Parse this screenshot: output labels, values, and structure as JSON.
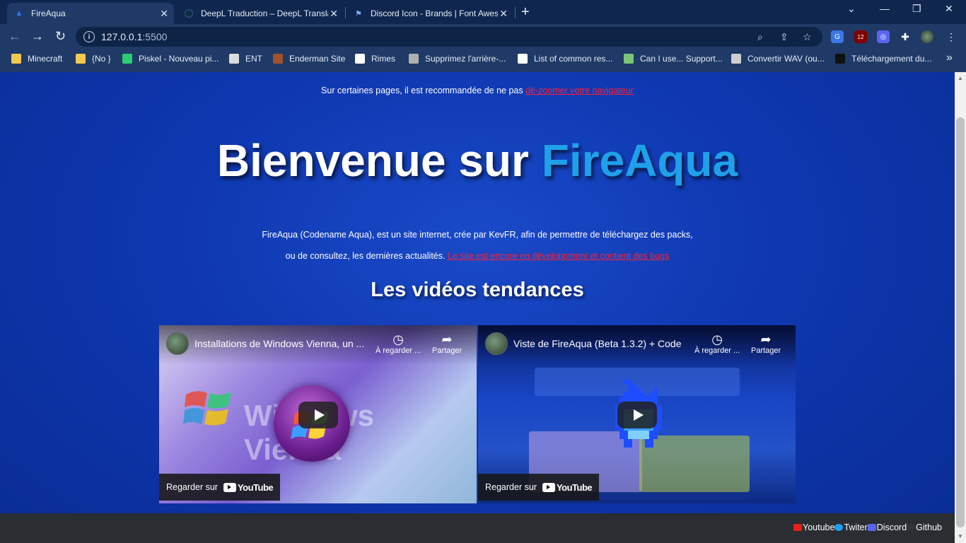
{
  "browser": {
    "tabs": [
      {
        "label": "FireAqua",
        "icon": "fireaqua-favicon",
        "active": true
      },
      {
        "label": "DeepL Traduction – DeepL Translat",
        "icon": "deepl-favicon",
        "active": false
      },
      {
        "label": "Discord Icon - Brands | Font Awes",
        "icon": "flag-favicon",
        "active": false
      }
    ],
    "new_tab_icon": "+",
    "window_controls": {
      "dropdown": "⌄",
      "minimize": "—",
      "restore": "❐",
      "close": "✕"
    },
    "address": {
      "host": "127.0.0.1",
      "port": ":5500"
    },
    "extensions": [
      {
        "name": "google-translate",
        "color": "#3b78e7",
        "glyph": "G"
      },
      {
        "name": "ublock",
        "color": "#800000",
        "glyph": "12"
      },
      {
        "name": "discord-ext",
        "color": "#5865f2",
        "glyph": "◎"
      }
    ],
    "bookmarks": [
      {
        "label": "Minecraft",
        "color": "#f2c94c"
      },
      {
        "label": "{No }",
        "color": "#f2c94c"
      },
      {
        "label": "Piskel - Nouveau pi...",
        "color": "#2ecc71"
      },
      {
        "label": "ENT",
        "color": "#dcdcdc"
      },
      {
        "label": "Enderman Site",
        "color": "#a0522d"
      },
      {
        "label": "Rimes",
        "color": "#ffffff"
      },
      {
        "label": "Supprimez l'arrière-...",
        "color": "#b0b0b0"
      },
      {
        "label": "List of common res...",
        "color": "#ffffff"
      },
      {
        "label": "Can I use... Support...",
        "color": "#7cc576"
      },
      {
        "label": "Convertir WAV (ou...",
        "color": "#cfcfcf"
      },
      {
        "label": "Téléchargement du...",
        "color": "#111111"
      }
    ],
    "more_bookmarks": "»"
  },
  "page": {
    "notice_text": "Sur certaines pages, il est recommandée de ne pas ",
    "notice_link": "dé-zoomer votre navigateur",
    "hero_prefix": "Bienvenue sur ",
    "hero_brand": "FireAqua",
    "desc_line1": "FireAqua (Codename Aqua), est un site internet, crée par KevFR, afin de permettre de téléchargez des packs,",
    "desc_line2_text": "ou de consultez, les dernières actualités. ",
    "desc_line2_link": "Le site est encore en développment et contient des bugs",
    "videos_title": "Les vidéos tendances",
    "videos": [
      {
        "title": "Installations de Windows Vienna, un ...",
        "overlay": "Windows Vienna",
        "watch_later": "À regarder ...",
        "share": "Partager",
        "watch_on": "Regarder sur",
        "yt": "YouTube"
      },
      {
        "title": "Viste de FireAqua (Beta 1.3.2) + Code",
        "watch_later": "À regarder ...",
        "share": "Partager",
        "watch_on": "Regarder sur",
        "yt": "YouTube"
      }
    ]
  },
  "footer": {
    "links": [
      {
        "label": "Youtube",
        "color": "#e62117"
      },
      {
        "label": "Twiter",
        "color": "#1da1f2"
      },
      {
        "label": "Discord",
        "color": "#5865f2"
      },
      {
        "label": "Github",
        "color": "#333333"
      }
    ]
  },
  "colors": {
    "accent_brand": "#1fa0ea",
    "link_red": "#ff2030",
    "page_bg": "#0e37b0"
  }
}
